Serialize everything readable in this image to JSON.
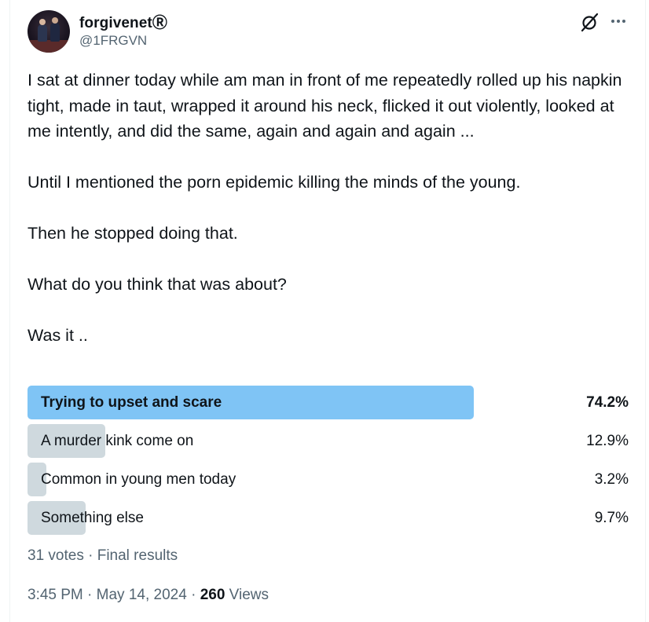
{
  "author": {
    "display_name": "forgivenetⓇ",
    "handle": "@1FRGVN"
  },
  "header_icons": [
    "grok-icon",
    "more-icon"
  ],
  "tweet": {
    "paragraphs": [
      "I sat at dinner today while am man in front of me repeatedly rolled up his napkin tight, made in taut, wrapped it around his neck, flicked it out violently, looked at me intently, and did the same, again and again and again ...",
      "Until I mentioned the porn epidemic killing the minds of the young.",
      "Then he stopped doing that.",
      "What do you think that was about?",
      "Was it .."
    ]
  },
  "poll": {
    "options": [
      {
        "label": "Trying to upset and scare",
        "percent_text": "74.2%",
        "percent": 74.2,
        "winner": true
      },
      {
        "label": "A murder kink come on",
        "percent_text": "12.9%",
        "percent": 12.9,
        "winner": false
      },
      {
        "label": "Common in young men today",
        "percent_text": "3.2%",
        "percent": 3.2,
        "winner": false
      },
      {
        "label": "Something else",
        "percent_text": "9.7%",
        "percent": 9.7,
        "winner": false
      }
    ],
    "votes_text": "31 votes",
    "separator": " · ",
    "status_text": "Final results",
    "winner_color": "#7fc4f5",
    "bar_color": "#cfd9de"
  },
  "meta": {
    "time": "3:45 PM",
    "date": "May 14, 2024",
    "separator": " · ",
    "views_count": "260",
    "views_label": " Views"
  }
}
